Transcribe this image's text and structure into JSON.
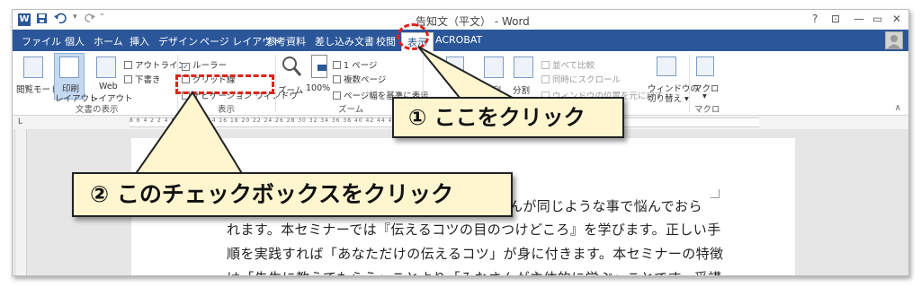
{
  "titlebar": {
    "word_icon": "W",
    "save_icon": "save-icon",
    "undo_icon": "undo-icon",
    "redo_icon": "redo-icon",
    "qa_more": "₹",
    "doc_title": "告知文（平文） - Word",
    "help": "?",
    "ribbon_display": "⊡",
    "minimize": "—",
    "restore": "▭",
    "close": "✕"
  },
  "tabs": [
    {
      "label": "ファイル"
    },
    {
      "label": "個人"
    },
    {
      "label": "ホーム"
    },
    {
      "label": "挿入"
    },
    {
      "label": "デザイン"
    },
    {
      "label": "ページ レイアウト"
    },
    {
      "label": "参考資料"
    },
    {
      "label": "差し込み文書"
    },
    {
      "label": "校閲"
    },
    {
      "label": "表示"
    },
    {
      "label": "ACROBAT"
    }
  ],
  "ribbon": {
    "views": {
      "read_mode": "閲覧モード",
      "print_layout_1": "印刷",
      "print_layout_2": "レイアウト",
      "web_layout_1": "Web",
      "web_layout_2": "レイアウト",
      "outline": "アウトライン",
      "draft": "下書き",
      "group": "文書の表示"
    },
    "show": {
      "ruler": "ルーラー",
      "gridlines": "グリッド線",
      "navigation_pane": "ナビゲーション ウィンドウ",
      "group": "表示",
      "ruler_checked": true,
      "gridlines_checked": false,
      "navigation_checked": false
    },
    "zoom": {
      "zoom": "ズーム",
      "hundred": "100%",
      "one_page": "1 ページ",
      "multiple_pages": "複数ページ",
      "page_width": "ページ幅を基準に表示",
      "group": "ズーム"
    },
    "window": {
      "arrange": "整列",
      "split": "分割",
      "side_by_side": "並べて比較",
      "sync_scroll": "同時にスクロール",
      "reset_position": "ウィンドウの位置を元に戻す",
      "switch_1": "ウィンドウの",
      "switch_2": "切り替え ▾",
      "partial": "ウ"
    },
    "macros": {
      "macro": "マクロ",
      "arrow": "▾",
      "group": "マクロ"
    }
  },
  "ruler": {
    "numbers": "8 6 4 2   2 4 6 8 10 12 14 16 18 20 22 24 26 28 30 32 34 36 38 40 42 44 46 48 50"
  },
  "document": {
    "line1": "んが同じような事で悩んでおら",
    "line2": "れます。本セミナーでは『伝えるコツの目のつけどころ』を学びます。正しい手",
    "line3": "順を実践すれば「あなただけの伝えるコツ」が身に付きます。本セミナーの特徴",
    "line4": "は「先生に教えてもらう」ことより「みなさんが主体的に学ぶ」ことです。受講"
  },
  "callouts": {
    "step1": "① ここをクリック",
    "step2": "② このチェックボックスをクリック"
  },
  "colors": {
    "accent": "#2b579a",
    "highlight": "#e0211b",
    "callout_bg": "#fff6d0"
  }
}
